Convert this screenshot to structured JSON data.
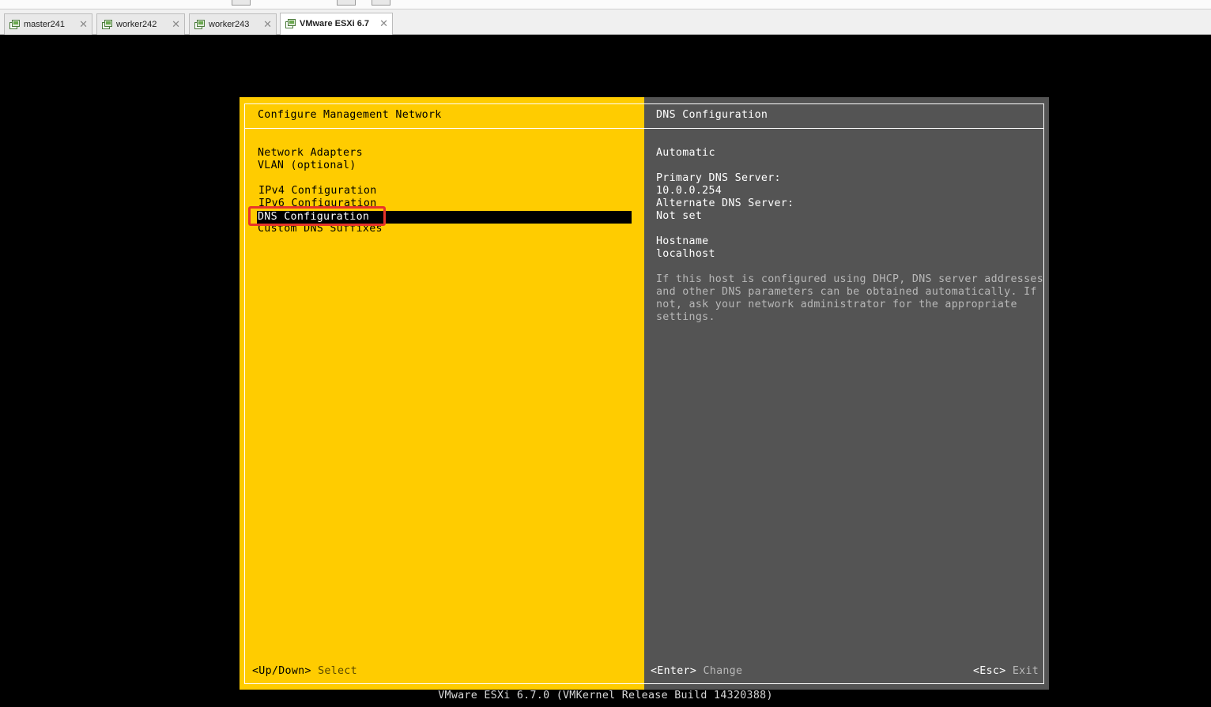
{
  "tabs": [
    {
      "label": "master241",
      "icon": "vm-icon"
    },
    {
      "label": "worker242",
      "icon": "vm-icon"
    },
    {
      "label": "worker243",
      "icon": "vm-icon"
    },
    {
      "label": "VMware ESXi 6.7",
      "icon": "vm-icon",
      "active": true
    }
  ],
  "tab_close_glyph": "✕",
  "left_pane": {
    "title": "Configure Management Network",
    "menu": [
      "Network Adapters",
      "VLAN (optional)",
      "IPv4 Configuration",
      "IPv6 Configuration",
      "DNS Configuration",
      "Custom DNS Suffixes"
    ],
    "selected_index": 4,
    "footer_key": "<Up/Down>",
    "footer_action": "Select"
  },
  "right_pane": {
    "title": "DNS Configuration",
    "mode": "Automatic",
    "primary_label": "Primary DNS Server:",
    "primary_value": "10.0.0.254",
    "alternate_label": "Alternate DNS Server:",
    "alternate_value": "Not set",
    "hostname_label": "Hostname",
    "hostname_value": "localhost",
    "help_lines": [
      "If this host is configured using DHCP, DNS server addresses",
      "and other DNS parameters can be obtained automatically. If",
      "not, ask your network administrator for the appropriate",
      "settings."
    ],
    "enter_key": "<Enter>",
    "enter_action": "Change",
    "esc_key": "<Esc>",
    "esc_action": "Exit"
  },
  "status_line": "VMware ESXi 6.7.0 (VMKernel Release Build 14320388)",
  "colors": {
    "left_pane_bg": "#ffcc00",
    "right_pane_bg": "#545454",
    "highlight_box": "#e8342a"
  }
}
